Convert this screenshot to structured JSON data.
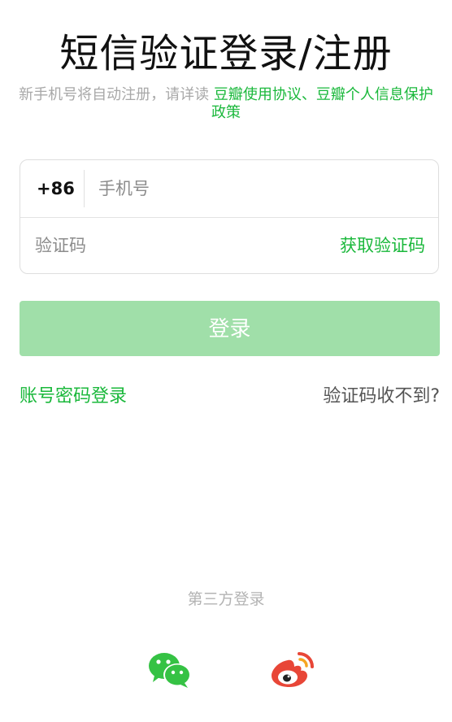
{
  "header": {
    "title": "短信验证登录/注册",
    "notice_prefix": "新手机号将自动注册，请详读 ",
    "notice_links": "豆瓣使用协议、豆瓣个人信息保护政策"
  },
  "form": {
    "country_code": "+86",
    "phone_placeholder": "手机号",
    "phone_value": "",
    "code_placeholder": "验证码",
    "code_value": "",
    "get_code_label": "获取验证码"
  },
  "actions": {
    "login_label": "登录",
    "password_login_label": "账号密码登录",
    "no_code_label": "验证码收不到?"
  },
  "third_party": {
    "label": "第三方登录",
    "providers": [
      "wechat-icon",
      "weibo-icon"
    ]
  },
  "colors": {
    "accent_green": "#1ab83b",
    "login_button_disabled": "#a0dfa9",
    "wechat_green": "#35c244",
    "weibo_red": "#e84637",
    "weibo_orange": "#f5a623"
  }
}
